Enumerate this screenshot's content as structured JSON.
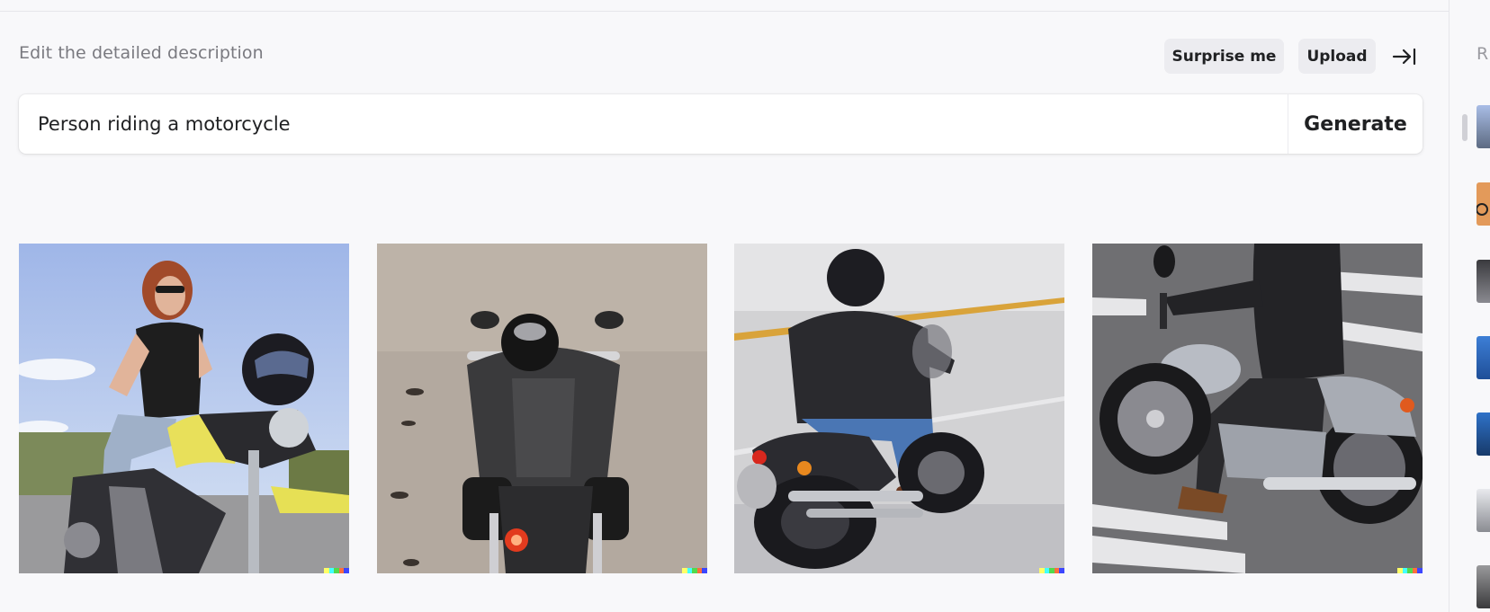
{
  "editor": {
    "label": "Edit the detailed description",
    "surprise_label": "Surprise me",
    "upload_label": "Upload",
    "prompt_value": "Person riding a motorcycle",
    "generate_label": "Generate"
  },
  "results": [
    {
      "subject": "woman-on-yellow-motorcycle"
    },
    {
      "subject": "rider-top-view-leather-jacket"
    },
    {
      "subject": "rider-black-cruiser-rear-view"
    },
    {
      "subject": "rider-silver-cruiser-crosswalk"
    }
  ],
  "sidebar": {
    "title_initial": "R",
    "thumbnails": 7
  },
  "colors": {
    "background": "#f8f8fa",
    "button_bg": "#ececf0",
    "text_primary": "#202123",
    "text_muted": "#7a7a80",
    "watermark": [
      "#ffff66",
      "#42ffff",
      "#51da4c",
      "#ff6e3c",
      "#3c46ff"
    ]
  }
}
